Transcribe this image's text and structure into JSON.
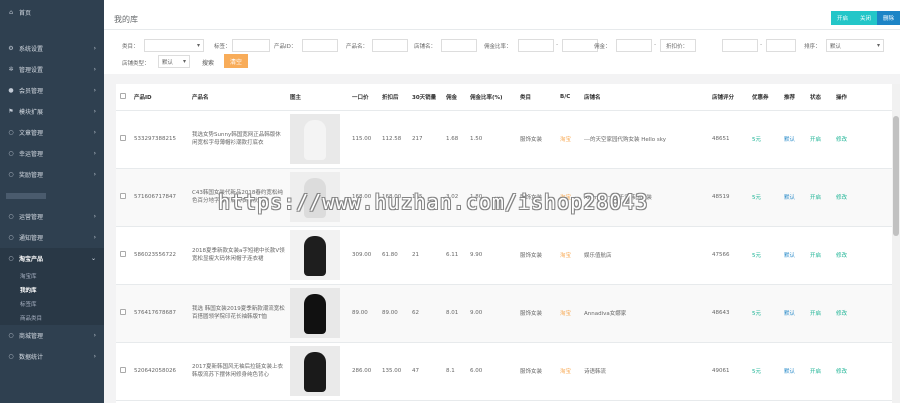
{
  "sidebar": {
    "home": "首页",
    "items": [
      {
        "label": "系统设置",
        "icon": "gear-icon",
        "glyph": "⚙"
      },
      {
        "label": "管理设置",
        "icon": "gears-icon",
        "glyph": "✲"
      },
      {
        "label": "会员管理",
        "icon": "user-icon",
        "glyph": "●"
      },
      {
        "label": "模块扩展",
        "icon": "flag-icon",
        "glyph": "⚑"
      },
      {
        "label": "文章管理",
        "icon": "circle-icon",
        "glyph": "○"
      },
      {
        "label": "幸运管理",
        "icon": "circle-icon",
        "glyph": "○"
      },
      {
        "label": "奖励管理",
        "icon": "circle-icon",
        "glyph": "○"
      },
      {
        "label": "",
        "icon": "circle-icon",
        "glyph": ""
      },
      {
        "label": "运营管理",
        "icon": "circle-icon",
        "glyph": "○"
      },
      {
        "label": "通知管理",
        "icon": "circle-icon",
        "glyph": "○"
      }
    ],
    "active": {
      "label": "淘宝产品",
      "glyph": "○"
    },
    "sub": [
      "淘宝库",
      "我的库",
      "标签库",
      "商品类目"
    ],
    "bottom": [
      {
        "label": "商城管理",
        "glyph": "○"
      },
      {
        "label": "数据统计",
        "glyph": "○"
      }
    ]
  },
  "header": {
    "title": "我的库",
    "buttons": [
      "开启",
      "关闭",
      "删除"
    ]
  },
  "filters": {
    "category_label": "类目：",
    "tag_label": "标签：",
    "product_id_label": "产品ID：",
    "product_name_label": "产品名：",
    "shop_name_label": "店铺名：",
    "commission_ratio_label": "佣金比率：",
    "commission_label": "佣金：",
    "discount_price_label": "折扣价：",
    "sort_label": "排序：",
    "sort_value": "默认",
    "shop_type_label": "店铺类型：",
    "shop_type_value": "默认",
    "search_label": "搜索",
    "clear_label": "清空"
  },
  "table": {
    "headers": [
      "",
      "产品ID",
      "产品名",
      "图主",
      "一口价",
      "折扣后",
      "30天销量",
      "佣金",
      "佣金比率(%)",
      "类目",
      "B/C",
      "店铺名",
      "店铺评分",
      "优惠券",
      "推荐",
      "状态",
      "操作"
    ],
    "rows": [
      {
        "id": "533297388215",
        "name": "我选女势Sunny韩国宽网正品韩版休闲宽松字母薄帽衫潮款打底衣",
        "price": "115.00",
        "discount": "112.58",
        "sales": "217",
        "commission": "1.68",
        "ratio": "1.50",
        "category": "服饰女装",
        "bc": "淘宝",
        "shop": "---的天空家园代购女装 Hello sky",
        "score": "48651",
        "coupon": "5元",
        "recommend": "默认",
        "status": "开启",
        "action": "修改",
        "thumb": "#e9e9e9",
        "fig": "#f4f4f4"
      },
      {
        "id": "571606717847",
        "name": "C43韩国女装代新品2018春约宽松纯色百分地字母打底大衣初秋通勤",
        "price": "168.00",
        "discount": "168.00",
        "sales": "145",
        "commission": "3.02",
        "ratio": "1.80",
        "category": "服饰女装",
        "bc": "淘宝",
        "shop": "Alumu_n一小千宝韩国女装",
        "score": "48519",
        "coupon": "5元",
        "recommend": "默认",
        "status": "开启",
        "action": "修改",
        "thumb": "#eeeeee",
        "fig": "#dcdcdc"
      },
      {
        "id": "586023556722",
        "name": "2018夏季新款女装a字短裙中长款V领宽松显瘦大码休闲帽子连衣裙",
        "price": "309.00",
        "discount": "61.80",
        "sales": "21",
        "commission": "6.11",
        "ratio": "9.90",
        "category": "服饰女装",
        "bc": "淘宝",
        "shop": "娱乐值航店",
        "score": "47566",
        "coupon": "5元",
        "recommend": "默认",
        "status": "开启",
        "action": "修改",
        "thumb": "#f2f2f2",
        "fig": "#1e1e1e"
      },
      {
        "id": "576417678687",
        "name": "我选 韩国女装2019夏季新款潮流宽松百搭圆领学院印花长袖韩版T恤",
        "price": "89.00",
        "discount": "89.00",
        "sales": "62",
        "commission": "8.01",
        "ratio": "9.00",
        "category": "服饰女装",
        "bc": "淘宝",
        "shop": "Annadiva女娜家",
        "score": "48643",
        "coupon": "5元",
        "recommend": "默认",
        "status": "开启",
        "action": "修改",
        "thumb": "#e8e8e8",
        "fig": "#111111"
      },
      {
        "id": "520642058026",
        "name": "2017夏新韩国风无袖后拉链女装上衣韩版流苏下摆休闲修身纯色背心",
        "price": "286.00",
        "discount": "135.00",
        "sales": "47",
        "commission": "8.1",
        "ratio": "6.00",
        "category": "服饰女装",
        "bc": "淘宝",
        "shop": "诗语韩流",
        "score": "49061",
        "coupon": "5元",
        "recommend": "默认",
        "status": "开启",
        "action": "修改",
        "thumb": "#eaeaea",
        "fig": "#1a1a1a"
      }
    ]
  },
  "watermark": "https://www.huzhan.com/ishop28043",
  "colors": {
    "sidebar": "#2f4050",
    "accent": "#1ab394",
    "warn": "#f8ac59",
    "link": "#1c84c6"
  }
}
